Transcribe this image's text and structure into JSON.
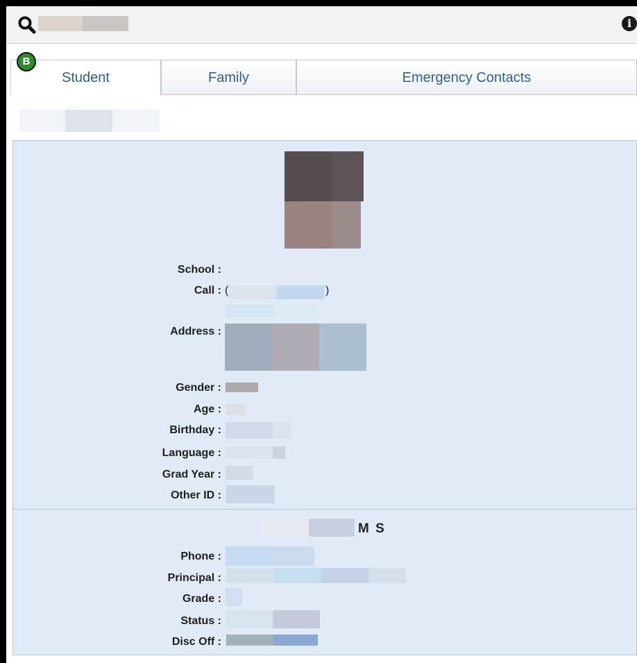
{
  "topbar": {
    "icons": {
      "search": "search-icon",
      "info": "info-icon"
    },
    "info_glyph": "i"
  },
  "tabs": [
    {
      "label": "Student",
      "active": true
    },
    {
      "label": "Family",
      "active": false
    },
    {
      "label": "Emergency Contacts",
      "active": false
    }
  ],
  "badge": {
    "letter": "B",
    "color": "#2e8b2e"
  },
  "student": {
    "fields": {
      "school": "School :",
      "call": "Call :",
      "address": "Address :",
      "gender": "Gender :",
      "age": "Age :",
      "birthday": "Birthday :",
      "language": "Language :",
      "grad_year": "Grad Year :",
      "other_id": "Other ID :"
    },
    "call_open": "(",
    "call_close": ")"
  },
  "school_info": {
    "heading_suffix": "M S",
    "fields": {
      "phone": "Phone :",
      "principal": "Principal :",
      "grade": "Grade :",
      "status": "Status :",
      "disc_off": "Disc Off :"
    }
  },
  "colors": {
    "panel_bg": "#e1ebf7",
    "tab_text": "#2f5e8f",
    "topbar_bg": "#f2f2f2"
  }
}
